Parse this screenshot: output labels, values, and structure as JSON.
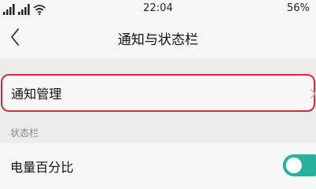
{
  "status_bar": {
    "time": "22:04",
    "battery": "56%",
    "icons": [
      "signal-icon",
      "signal-icon",
      "wifi-icon"
    ]
  },
  "header": {
    "title": "通知与状态栏",
    "back_icon": "chevron-left-icon"
  },
  "settings": {
    "notification_management": "通知管理",
    "status_bar_section": "状态栏",
    "battery_percentage": "电量百分比",
    "battery_percentage_enabled": true
  },
  "colors": {
    "toggle_on": "#25b29a",
    "highlight_border": "#d62b3a"
  }
}
